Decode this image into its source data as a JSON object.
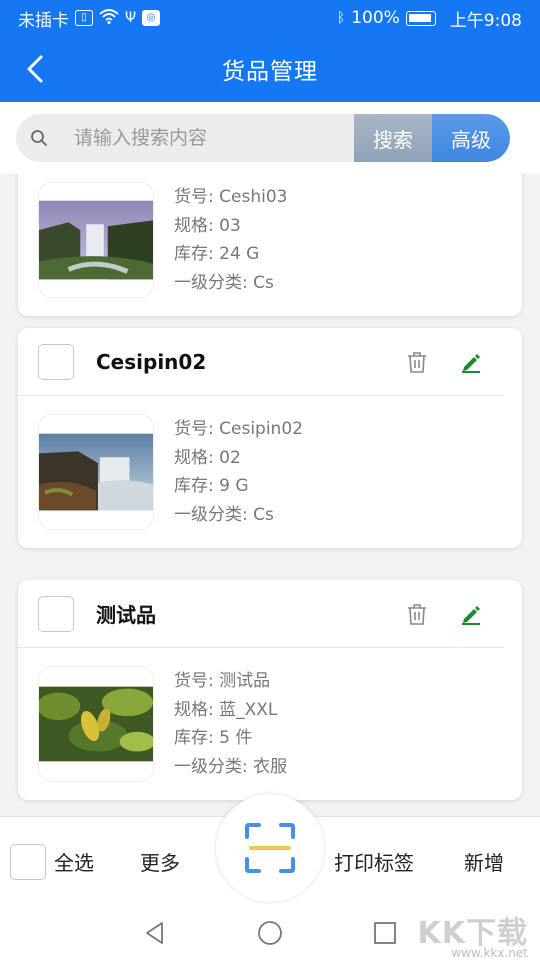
{
  "status_bar": {
    "carrier": "未插卡",
    "battery": "100%",
    "time": "上午9:08"
  },
  "header": {
    "title": "货品管理"
  },
  "search": {
    "placeholder": "请输入搜索内容",
    "value": "",
    "search_label": "搜索",
    "advanced_label": "高级"
  },
  "products": [
    {
      "name": "",
      "fields": [
        "货号: Ceshi03",
        "规格: 03",
        "库存: 24 G",
        "一级分类: Cs"
      ],
      "image": "waterfall"
    },
    {
      "name": "Cesipin02",
      "fields": [
        "货号: Cesipin02",
        "规格: 02",
        "库存: 9 G",
        "一级分类: Cs"
      ],
      "image": "coastal-waterfall"
    },
    {
      "name": "测试品",
      "fields": [
        "货号: 测试品",
        "规格: 蓝_XXL",
        "库存: 5 件",
        "一级分类: 衣服"
      ],
      "image": "leaves"
    }
  ],
  "toolbar": {
    "select_all": "全选",
    "more": "更多",
    "print_label": "打印标签",
    "add": "新增"
  },
  "icons": {
    "back": "chevron-left-icon",
    "search": "search-icon",
    "delete": "trash-icon",
    "edit": "pencil-icon",
    "scan": "scan-icon"
  },
  "colors": {
    "primary": "#1677f5",
    "edit_icon": "#1a8a2e",
    "scan_corners": "#4a90e2",
    "scan_line": "#f2c94c"
  },
  "watermark": {
    "text": "KK下载",
    "url": "www.kkx.net"
  }
}
